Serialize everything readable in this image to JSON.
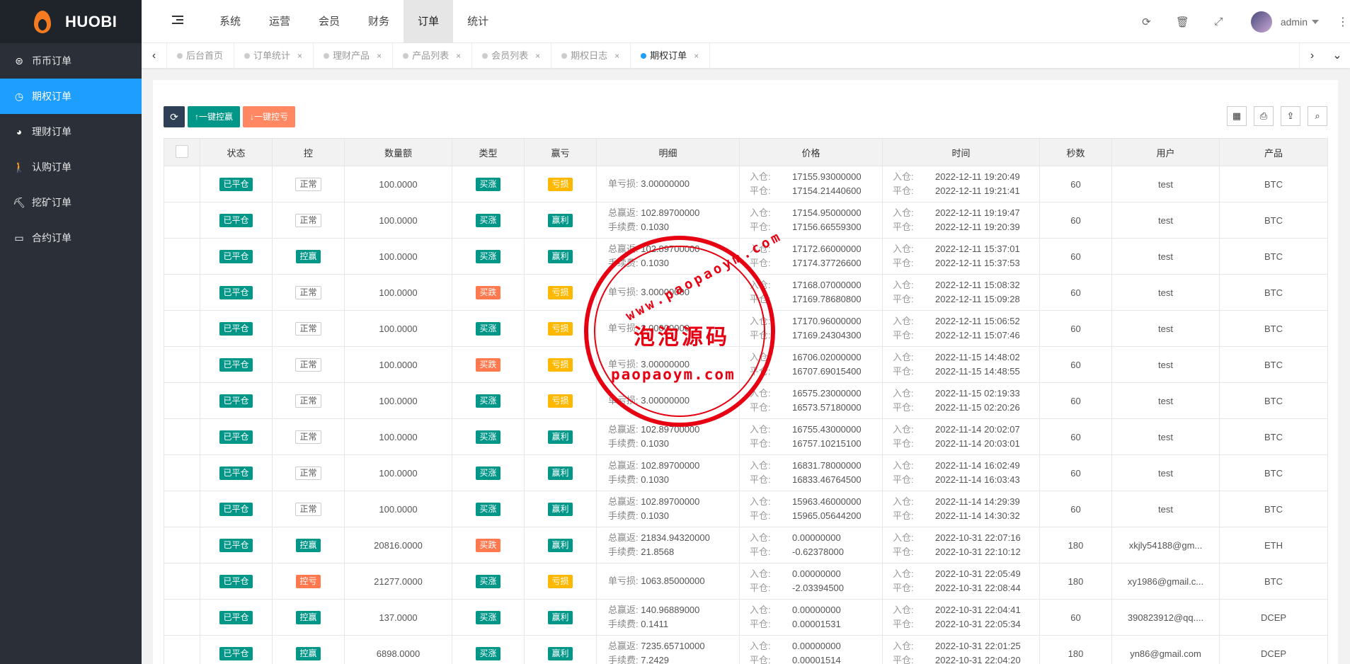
{
  "brand": {
    "name": "HUOBI"
  },
  "sidebar": {
    "items": [
      {
        "label": "币币订单",
        "icon": "coin-exchange-icon",
        "active": false
      },
      {
        "label": "期权订单",
        "icon": "clock-icon",
        "active": true
      },
      {
        "label": "理财订单",
        "icon": "palette-icon",
        "active": false
      },
      {
        "label": "认购订单",
        "icon": "walker-icon",
        "active": false
      },
      {
        "label": "挖矿订单",
        "icon": "mining-icon",
        "active": false
      },
      {
        "label": "合约订单",
        "icon": "monitor-icon",
        "active": false
      }
    ]
  },
  "header": {
    "nav": [
      {
        "label": "系统",
        "active": false
      },
      {
        "label": "运营",
        "active": false
      },
      {
        "label": "会员",
        "active": false
      },
      {
        "label": "财务",
        "active": false
      },
      {
        "label": "订单",
        "active": true
      },
      {
        "label": "统计",
        "active": false
      }
    ],
    "user": "admin"
  },
  "tabs": [
    {
      "label": "后台首页",
      "closable": false,
      "active": false
    },
    {
      "label": "订单统计",
      "closable": true,
      "active": false
    },
    {
      "label": "理财产品",
      "closable": true,
      "active": false
    },
    {
      "label": "产品列表",
      "closable": true,
      "active": false
    },
    {
      "label": "会员列表",
      "closable": true,
      "active": false
    },
    {
      "label": "期权日志",
      "closable": true,
      "active": false
    },
    {
      "label": "期权订单",
      "closable": true,
      "active": true
    }
  ],
  "toolbar": {
    "control_win": "一键控赢",
    "control_lose": "一键控亏"
  },
  "table": {
    "headers": [
      "状态",
      "控",
      "数量额",
      "类型",
      "赢亏",
      "明细",
      "价格",
      "时间",
      "秒数",
      "用户",
      "产品"
    ],
    "labels": {
      "open_in": "入仓:",
      "close_out": "平仓:",
      "loss": "单亏损:",
      "total_win": "总赢返:",
      "fee": "手续费:"
    },
    "rows": [
      {
        "status": "已平仓",
        "ctrl": "正常",
        "amount": "100.0000",
        "type": "买涨",
        "result": "亏损",
        "detail": {
          "kind": "loss",
          "loss": "3.00000000"
        },
        "price_in": "17155.93000000",
        "price_out": "17154.21440600",
        "time_in": "2022-12-11 19:20:49",
        "time_out": "2022-12-11 19:21:41",
        "seconds": "60",
        "user": "test",
        "product": "BTC"
      },
      {
        "status": "已平仓",
        "ctrl": "正常",
        "amount": "100.0000",
        "type": "买涨",
        "result": "赢利",
        "detail": {
          "kind": "win",
          "total": "102.89700000",
          "fee": "0.1030"
        },
        "price_in": "17154.95000000",
        "price_out": "17156.66559300",
        "time_in": "2022-12-11 19:19:47",
        "time_out": "2022-12-11 19:20:39",
        "seconds": "60",
        "user": "test",
        "product": "BTC"
      },
      {
        "status": "已平仓",
        "ctrl": "控赢",
        "amount": "100.0000",
        "type": "买涨",
        "result": "赢利",
        "detail": {
          "kind": "win",
          "total": "102.89700000",
          "fee": "0.1030"
        },
        "price_in": "17172.66000000",
        "price_out": "17174.37726600",
        "time_in": "2022-12-11 15:37:01",
        "time_out": "2022-12-11 15:37:53",
        "seconds": "60",
        "user": "test",
        "product": "BTC"
      },
      {
        "status": "已平仓",
        "ctrl": "正常",
        "amount": "100.0000",
        "type": "买跌",
        "result": "亏损",
        "detail": {
          "kind": "loss",
          "loss": "3.00000000"
        },
        "price_in": "17168.07000000",
        "price_out": "17169.78680800",
        "time_in": "2022-12-11 15:08:32",
        "time_out": "2022-12-11 15:09:28",
        "seconds": "60",
        "user": "test",
        "product": "BTC"
      },
      {
        "status": "已平仓",
        "ctrl": "正常",
        "amount": "100.0000",
        "type": "买涨",
        "result": "亏损",
        "detail": {
          "kind": "loss",
          "loss": "3.00000000"
        },
        "price_in": "17170.96000000",
        "price_out": "17169.24304300",
        "time_in": "2022-12-11 15:06:52",
        "time_out": "2022-12-11 15:07:46",
        "seconds": "60",
        "user": "test",
        "product": "BTC"
      },
      {
        "status": "已平仓",
        "ctrl": "正常",
        "amount": "100.0000",
        "type": "买跌",
        "result": "亏损",
        "detail": {
          "kind": "loss",
          "loss": "3.00000000"
        },
        "price_in": "16706.02000000",
        "price_out": "16707.69015400",
        "time_in": "2022-11-15 14:48:02",
        "time_out": "2022-11-15 14:48:55",
        "seconds": "60",
        "user": "test",
        "product": "BTC"
      },
      {
        "status": "已平仓",
        "ctrl": "正常",
        "amount": "100.0000",
        "type": "买涨",
        "result": "亏损",
        "detail": {
          "kind": "loss",
          "loss": "3.00000000"
        },
        "price_in": "16575.23000000",
        "price_out": "16573.57180000",
        "time_in": "2022-11-15 02:19:33",
        "time_out": "2022-11-15 02:20:26",
        "seconds": "60",
        "user": "test",
        "product": "BTC"
      },
      {
        "status": "已平仓",
        "ctrl": "正常",
        "amount": "100.0000",
        "type": "买涨",
        "result": "赢利",
        "detail": {
          "kind": "win",
          "total": "102.89700000",
          "fee": "0.1030"
        },
        "price_in": "16755.43000000",
        "price_out": "16757.10215100",
        "time_in": "2022-11-14 20:02:07",
        "time_out": "2022-11-14 20:03:01",
        "seconds": "60",
        "user": "test",
        "product": "BTC"
      },
      {
        "status": "已平仓",
        "ctrl": "正常",
        "amount": "100.0000",
        "type": "买涨",
        "result": "赢利",
        "detail": {
          "kind": "win",
          "total": "102.89700000",
          "fee": "0.1030"
        },
        "price_in": "16831.78000000",
        "price_out": "16833.46764500",
        "time_in": "2022-11-14 16:02:49",
        "time_out": "2022-11-14 16:03:43",
        "seconds": "60",
        "user": "test",
        "product": "BTC"
      },
      {
        "status": "已平仓",
        "ctrl": "正常",
        "amount": "100.0000",
        "type": "买涨",
        "result": "赢利",
        "detail": {
          "kind": "win",
          "total": "102.89700000",
          "fee": "0.1030"
        },
        "price_in": "15963.46000000",
        "price_out": "15965.05644200",
        "time_in": "2022-11-14 14:29:39",
        "time_out": "2022-11-14 14:30:32",
        "seconds": "60",
        "user": "test",
        "product": "BTC"
      },
      {
        "status": "已平仓",
        "ctrl": "控赢",
        "amount": "20816.0000",
        "type": "买跌",
        "result": "赢利",
        "detail": {
          "kind": "win",
          "total": "21834.94320000",
          "fee": "21.8568"
        },
        "price_in": "0.00000000",
        "price_out": "-0.62378000",
        "time_in": "2022-10-31 22:07:16",
        "time_out": "2022-10-31 22:10:12",
        "seconds": "180",
        "user": "xkjly54188@gm...",
        "product": "ETH"
      },
      {
        "status": "已平仓",
        "ctrl": "控亏",
        "amount": "21277.0000",
        "type": "买涨",
        "result": "亏损",
        "detail": {
          "kind": "loss",
          "loss": "1063.85000000"
        },
        "price_in": "0.00000000",
        "price_out": "-2.03394500",
        "time_in": "2022-10-31 22:05:49",
        "time_out": "2022-10-31 22:08:44",
        "seconds": "180",
        "user": "xy1986@gmail.c...",
        "product": "BTC"
      },
      {
        "status": "已平仓",
        "ctrl": "控赢",
        "amount": "137.0000",
        "type": "买涨",
        "result": "赢利",
        "detail": {
          "kind": "win",
          "total": "140.96889000",
          "fee": "0.1411"
        },
        "price_in": "0.00000000",
        "price_out": "0.00001531",
        "time_in": "2022-10-31 22:04:41",
        "time_out": "2022-10-31 22:05:34",
        "seconds": "60",
        "user": "390823912@qq....",
        "product": "DCEP"
      },
      {
        "status": "已平仓",
        "ctrl": "控赢",
        "amount": "6898.0000",
        "type": "买涨",
        "result": "赢利",
        "detail": {
          "kind": "win",
          "total": "7235.65710000",
          "fee": "7.2429"
        },
        "price_in": "0.00000000",
        "price_out": "0.00001514",
        "time_in": "2022-10-31 22:01:25",
        "time_out": "2022-10-31 22:04:20",
        "seconds": "180",
        "user": "yn86@gmail.com",
        "product": "DCEP"
      }
    ]
  },
  "watermark": {
    "top": "www.paopaoym.com",
    "middle": "泡泡源码",
    "bottom": "paopaoym.com"
  },
  "colors": {
    "sidebar_bg": "#2a2f38",
    "accent_blue": "#1e9fff",
    "green": "#009688",
    "red": "#ff5722",
    "orange": "#ffb800",
    "stamp_red": "#e60012"
  }
}
